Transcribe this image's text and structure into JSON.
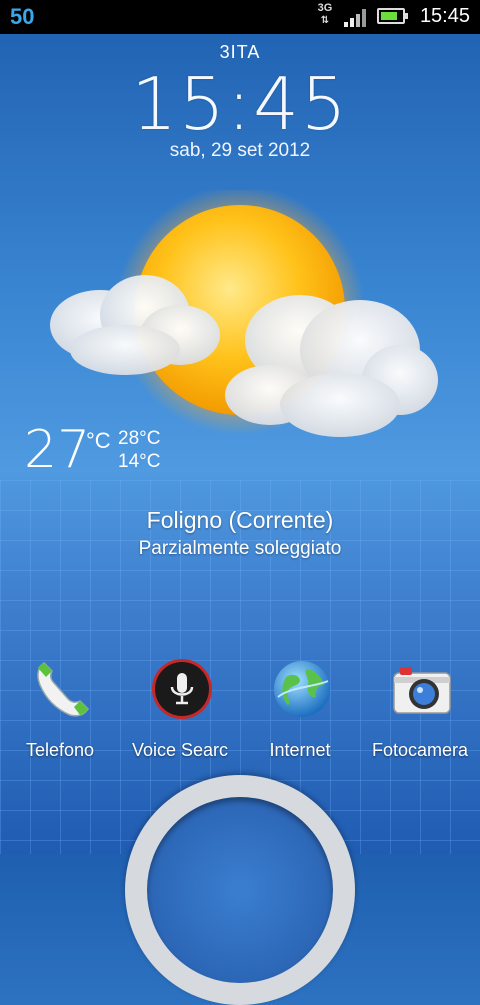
{
  "status_bar": {
    "notification_count": "50",
    "network": "3G",
    "signal_level": 1.0,
    "battery_level": 0.8,
    "time": "15:45"
  },
  "lockscreen": {
    "carrier": "3ITA",
    "clock": "15:45",
    "date": "sab, 29 set 2012"
  },
  "weather": {
    "current_temp": "27",
    "unit": "°C",
    "high": "28°C",
    "low": "14°C",
    "location": "Foligno (Corrente)",
    "condition": "Parzialmente soleggiato",
    "icon": "partly-sunny-icon"
  },
  "dock": [
    {
      "label": "Telefono",
      "icon": "phone-icon"
    },
    {
      "label": "Voice Searc",
      "icon": "microphone-icon"
    },
    {
      "label": "Internet",
      "icon": "globe-icon"
    },
    {
      "label": "Fotocamera",
      "icon": "camera-icon"
    }
  ],
  "colors": {
    "accent": "#39a7e8",
    "battery": "#6cdc3a"
  }
}
